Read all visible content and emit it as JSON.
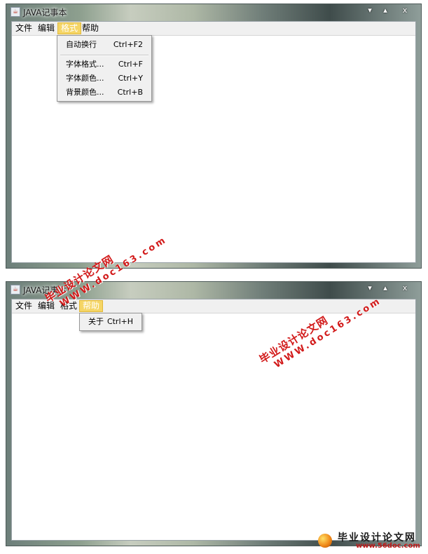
{
  "windows": [
    {
      "title": "JAVA记事本",
      "controls": {
        "minimize": "▾",
        "maximize": "▴",
        "close": "x"
      },
      "menus": [
        "文件",
        "编辑",
        "格式",
        "帮助"
      ],
      "active_menu": "格式",
      "dropdown": [
        {
          "label": "自动换行",
          "accel": "Ctrl+F2"
        },
        {
          "label": "字体格式...",
          "accel": "Ctrl+F"
        },
        {
          "label": "字体颜色...",
          "accel": "Ctrl+Y"
        },
        {
          "label": "背景颜色...",
          "accel": "Ctrl+B"
        }
      ]
    },
    {
      "title": "JAVA记事本",
      "controls": {
        "minimize": "▾",
        "maximize": "▴",
        "close": "x"
      },
      "menus": [
        "文件",
        "编辑",
        "格式",
        "帮助"
      ],
      "active_menu": "帮助",
      "dropdown": [
        {
          "label": "关于",
          "accel": "Ctrl+H"
        }
      ]
    }
  ],
  "watermarks": [
    {
      "line1": "毕业设计论文网",
      "line2": "WWW.doc163.com"
    },
    {
      "line1": "毕业设计论文网",
      "line2": "WWW.doc163.com"
    }
  ],
  "logo": {
    "text": "毕业设计论文网",
    "url": "www.56doc.com"
  },
  "colors": {
    "menu_highlight": "#f5d565",
    "watermark": "#d21a1a"
  }
}
